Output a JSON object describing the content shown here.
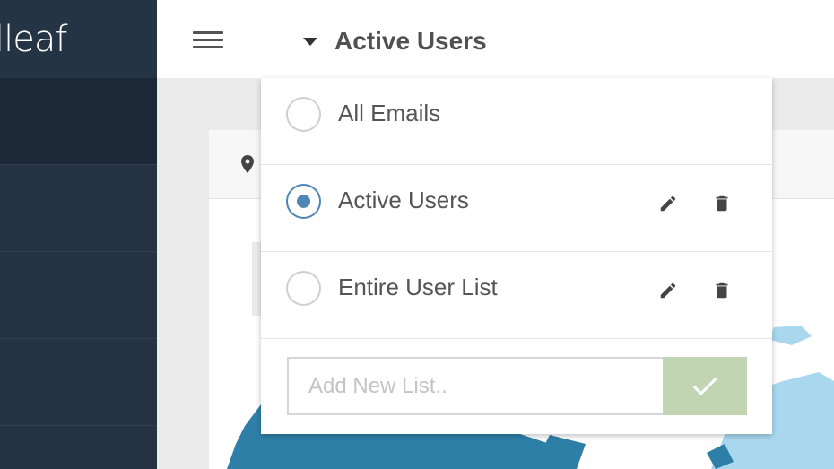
{
  "app": {
    "logo_text": "lleaf"
  },
  "header": {
    "title": "Active Users"
  },
  "dropdown": {
    "options": [
      {
        "label": "All Emails",
        "selected": false,
        "editable": false
      },
      {
        "label": "Active Users",
        "selected": true,
        "editable": true
      },
      {
        "label": "Entire User List",
        "selected": false,
        "editable": true
      }
    ],
    "add_input": {
      "placeholder": "Add New List..",
      "value": ""
    }
  },
  "colors": {
    "sidebar": "#243242",
    "radio_selected": "#4f86b3",
    "confirm_button": "#c2d5b2",
    "map_water": "#2e7fa8",
    "map_land": "#a9d8ee"
  },
  "icons": {
    "menu": "hamburger-icon",
    "caret": "caret-down-icon",
    "location": "map-marker-icon",
    "edit": "pencil-icon",
    "delete": "trash-icon",
    "confirm": "check-icon"
  }
}
